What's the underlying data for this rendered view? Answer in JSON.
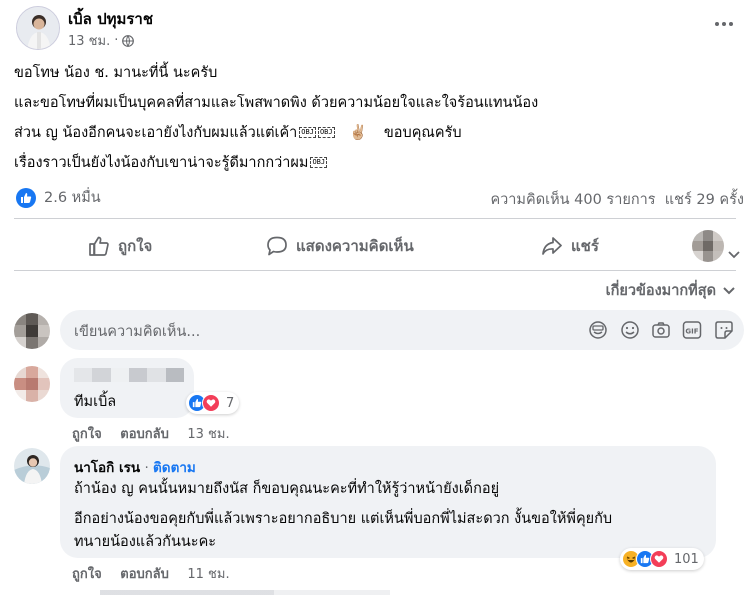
{
  "post": {
    "author": "เบิ้ล ปทุมราช",
    "time": "13 ชม.",
    "privacy_icon": "globe-icon",
    "lines": [
      "ขอโทษ น้อง ช.  มานะที่นี้ นะครับ",
      "และขอโทษที่ผมเป็นบุคคลที่สามและโพสพาดพิง ด้วยความน้อยใจและใจร้อนแทนน้อง",
      "ส่วน ญ น้องอีกคนจะเอายังไงกับผมแล้วแต่เค้า",
      "เรื่องราวเป็นยังไงน้องกับเขาน่าจะรู้ดีมากกว่าผม"
    ],
    "obj_marker": "OBJ",
    "peace_emoji": "✌🏼",
    "line3_suffix": "ขอบคุณครับ",
    "reaction_count": "2.6 หมื่น",
    "comments_shares": "ความคิดเห็น 400 รายการ  แชร์ 29 ครั้ง"
  },
  "actions": {
    "like": "ถูกใจ",
    "comment": "แสดงความคิดเห็น",
    "share": "แชร์"
  },
  "filter": {
    "label": "เกี่ยวข้องมากที่สุด"
  },
  "composer": {
    "placeholder": "เขียนความคิดเห็น...",
    "icons": [
      "sticker-icon",
      "emoji-icon",
      "camera-icon",
      "gif-icon",
      "sticker-square-icon"
    ]
  },
  "comments": [
    {
      "text": "ทีมเบิ้ล",
      "reaction_count": "7",
      "like": "ถูกใจ",
      "reply": "ตอบกลับ",
      "time": "13 ชม."
    },
    {
      "author": "นาโอกิ เรน",
      "follow": "ติดตาม",
      "lines": [
        "ถ้าน้อง ญ คนนั้นหมายถึงนัส ก็ขอบคุณนะคะที่ทำให้รู้ว่าหน้ายังเด็กอยู่",
        "อีกอย่างน้องขอคุยกับพี่แล้วเพราะอยากอธิบาย แต่เห็นพี่บอกพี่ไม่สะดวก งั้นขอให้พี่คุยกับ",
        "ทนายน้องแล้วกันนะคะ"
      ],
      "reaction_count": "101",
      "like": "ถูกใจ",
      "reply": "ตอบกลับ",
      "time": "11 ชม."
    }
  ],
  "colors": {
    "like_blue": "#1877f2",
    "love_red": "#f33e58",
    "haha_yellow": "#f7b125"
  }
}
